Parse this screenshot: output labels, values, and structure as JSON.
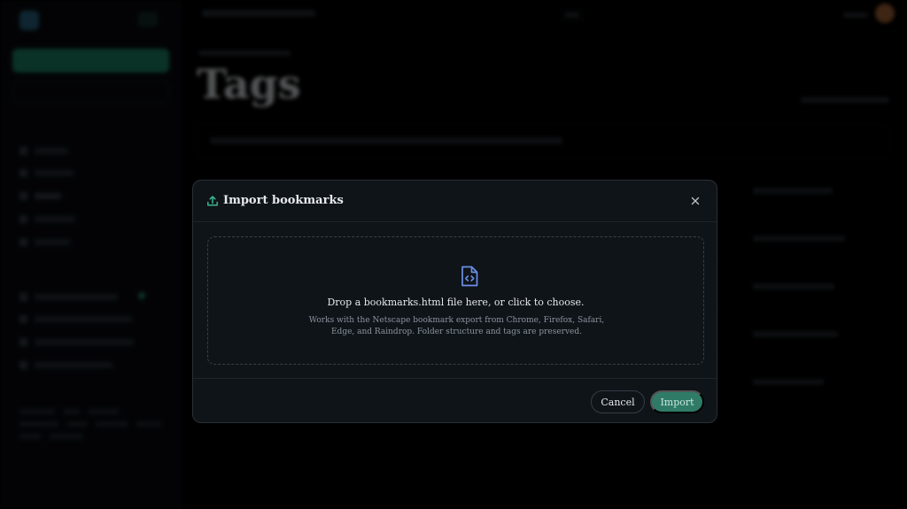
{
  "modal": {
    "title": "Import bookmarks",
    "dropzone_title": "Drop a bookmarks.html file here, or click to choose.",
    "dropzone_description": "Works with the Netscape bookmark export from Chrome, Firefox, Safari, Edge, and Raindrop. Folder structure and tags are preserved.",
    "cancel_label": "Cancel",
    "import_label": "Import",
    "icons": {
      "header": "upload-icon",
      "close": "close-icon",
      "dropzone": "code-file-icon"
    },
    "colors": {
      "accent": "#2f7b68",
      "icon_green": "#3fb594",
      "icon_blue": "#6b8fe8"
    }
  },
  "background": {
    "page_title": "Tags"
  }
}
